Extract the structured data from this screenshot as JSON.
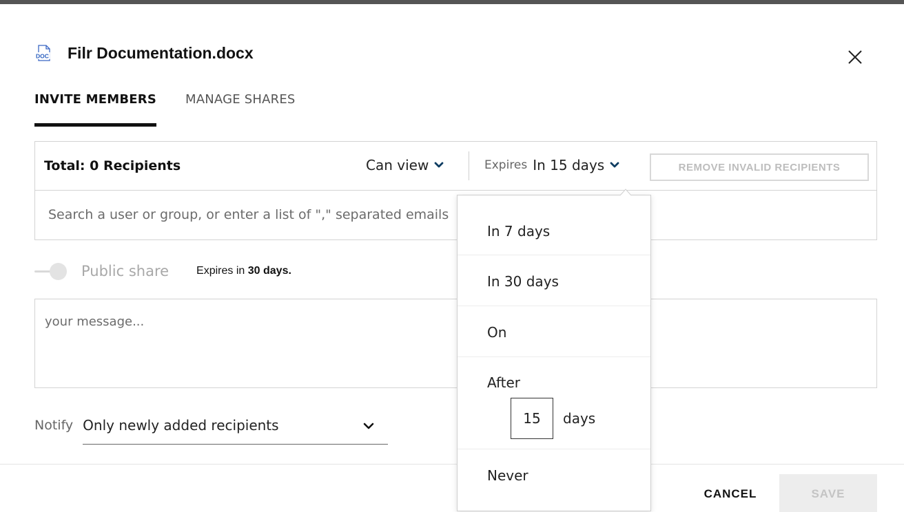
{
  "dialog": {
    "file_icon": "doc-file-icon",
    "file_icon_text": "DOC",
    "title": "Filr Documentation.docx",
    "close_icon": "close-icon"
  },
  "tabs": [
    {
      "label": "INVITE MEMBERS",
      "active": true
    },
    {
      "label": "MANAGE SHARES",
      "active": false
    }
  ],
  "recipients": {
    "total_label": "Total: 0 Recipients",
    "permission_value": "Can view",
    "expires_label": "Expires",
    "expires_value": "In 15 days",
    "remove_invalid_label": "REMOVE INVALID RECIPIENTS",
    "search_placeholder": "Search a user or group, or enter a list of \",\" separated emails"
  },
  "public_share": {
    "label": "Public share",
    "enabled": false,
    "expires_prefix": "Expires in",
    "expires_value": "30 days."
  },
  "message": {
    "placeholder": "your message..."
  },
  "notify": {
    "label": "Notify",
    "value": "Only newly added recipients"
  },
  "footer": {
    "cancel_label": "CANCEL",
    "save_label": "SAVE"
  },
  "expires_dropdown": {
    "options": [
      {
        "label": "In 7 days"
      },
      {
        "label": "In 30 days"
      },
      {
        "label": "On"
      },
      {
        "label": "After"
      },
      {
        "label": "Never"
      }
    ],
    "after_days_value": "15",
    "after_days_unit": "days"
  },
  "colors": {
    "accent_chevron": "#0d3c61",
    "doc_icon": "#2b5fbf",
    "disabled_text": "#c4c4c4"
  }
}
